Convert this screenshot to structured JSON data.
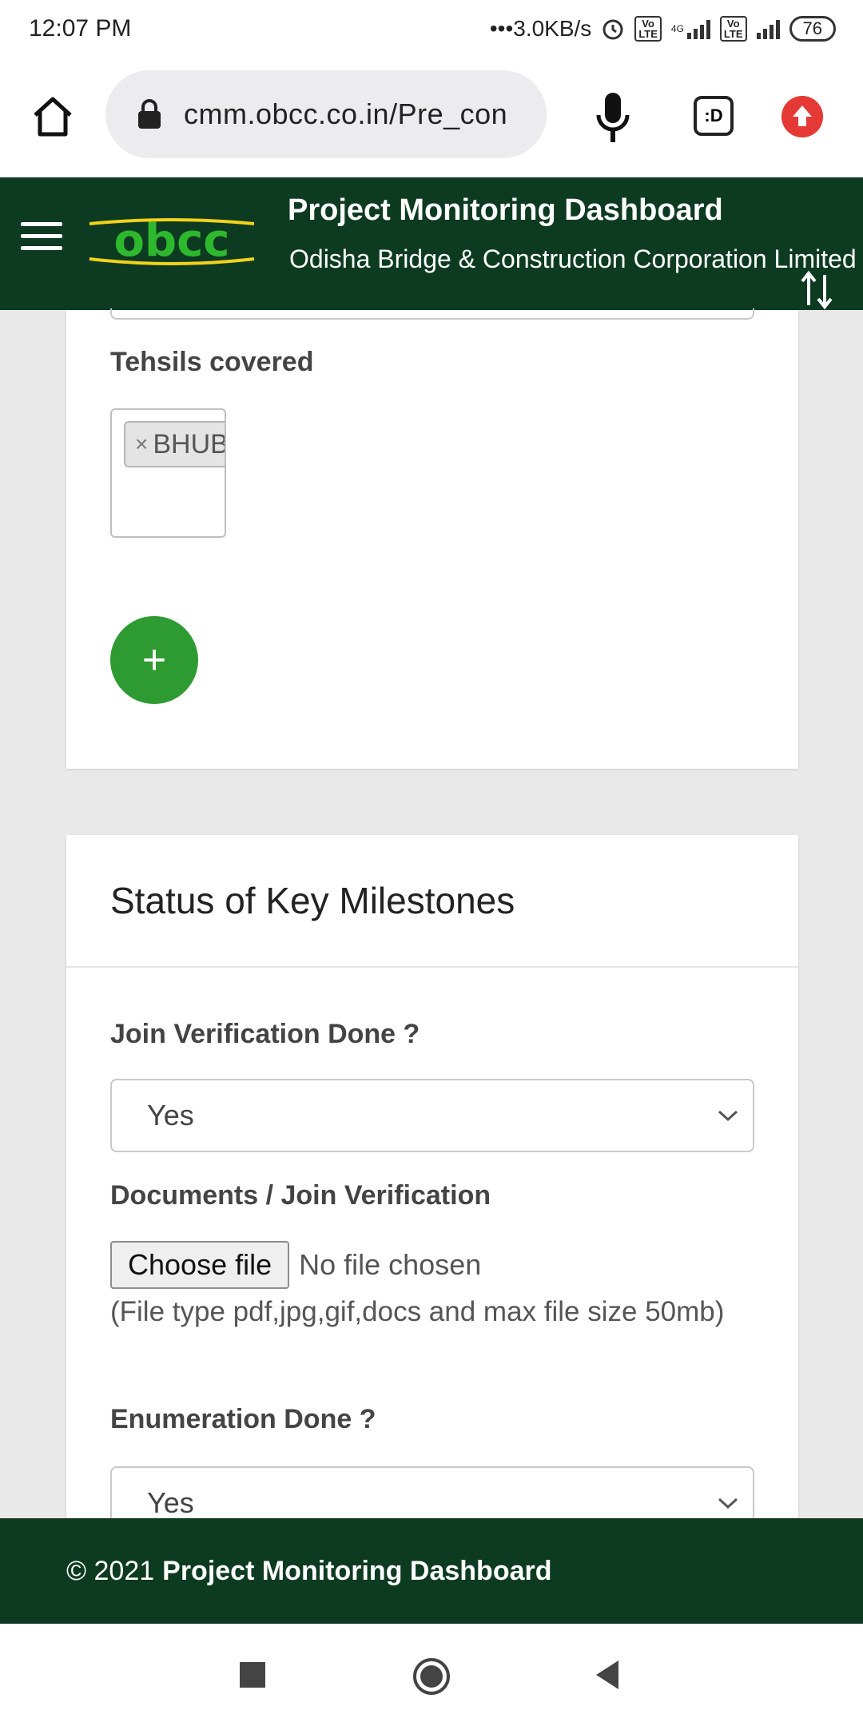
{
  "status_bar": {
    "time": "12:07 PM",
    "network_speed": "•••3.0KB/s",
    "signal_1_label": "4G",
    "volte_label": "Vo LTE",
    "battery": "76"
  },
  "browser": {
    "url": "cmm.obcc.co.in/Pre_con",
    "tab_icon_label": ":D"
  },
  "header": {
    "logo_text": "obcc",
    "title": "Project Monitoring Dashboard",
    "subtitle": "Odisha Bridge & Construction Corporation Limited"
  },
  "card_tehsils": {
    "label": "Tehsils covered",
    "chips": [
      {
        "remove": "×",
        "text": "BHUB"
      }
    ],
    "add_button": "+"
  },
  "card_milestones": {
    "title": "Status of Key Milestones",
    "join_verification": {
      "label": "Join Verification Done ?",
      "value": "Yes"
    },
    "documents": {
      "label": "Documents / Join Verification",
      "button": "Choose file",
      "status": "No file chosen",
      "hint": "(File type pdf,jpg,gif,docs and max file size 50mb)"
    },
    "enumeration": {
      "label": "Enumeration Done ?",
      "value": "Yes"
    }
  },
  "footer": {
    "copyright": "© 2021",
    "brand": "Project Monitoring Dashboard"
  },
  "colors": {
    "header_bg": "#0d3b21",
    "accent_green": "#2e9b32",
    "logo_yellow": "#f2d21b",
    "update_red": "#e53935"
  }
}
